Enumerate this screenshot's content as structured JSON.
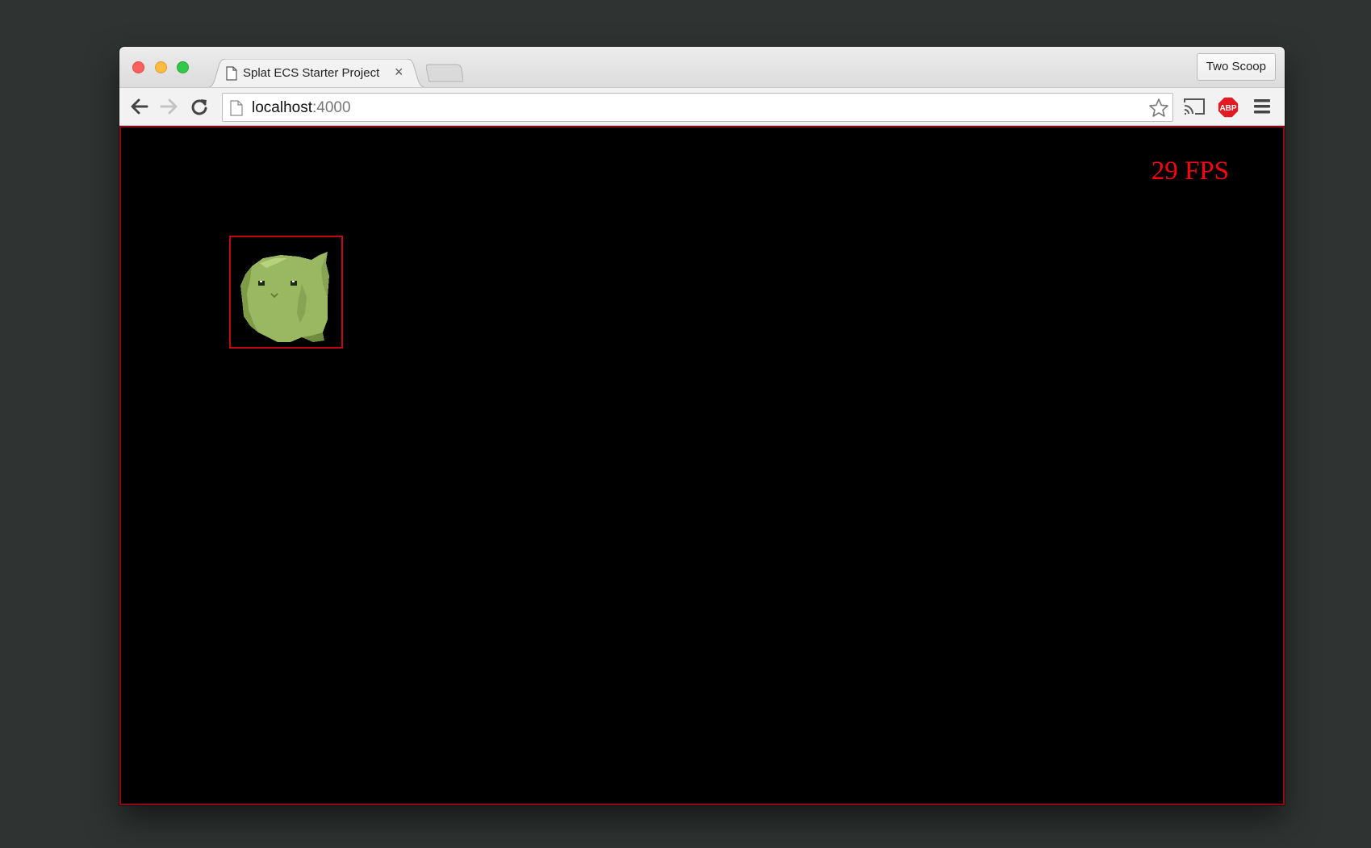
{
  "browser": {
    "tab": {
      "title": "Splat ECS Starter Project",
      "close_glyph": "×"
    },
    "profile_name": "Two Scoop",
    "address": {
      "host": "localhost",
      "port": ":4000"
    }
  },
  "page": {
    "fps_value": "29",
    "fps_unit": "FPS"
  },
  "colors": {
    "desktop": "#2f3432",
    "canvas": "#000000",
    "fps_text": "#ff0010",
    "bounding_box": "#c00812",
    "slime": "#9ab862"
  },
  "icons": [
    "back-arrow-icon",
    "forward-arrow-icon",
    "reload-icon",
    "page-icon",
    "star-icon",
    "cast-icon",
    "adblock-plus-icon",
    "hamburger-menu-icon",
    "slime-sprite"
  ]
}
